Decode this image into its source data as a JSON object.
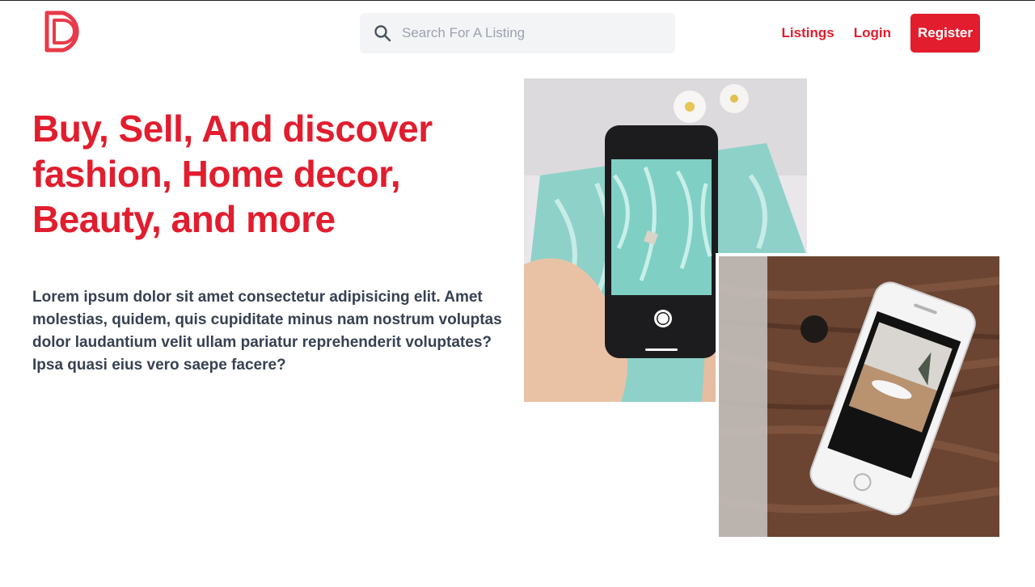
{
  "header": {
    "logo_label": "D logo",
    "search_placeholder": "Search For A Listing",
    "nav": {
      "listings_label": "Listings",
      "login_label": "Login",
      "register_label": "Register"
    }
  },
  "hero": {
    "headline": "Buy, Sell, And discover fashion, Home decor, Beauty, and more",
    "lead": "Lorem ipsum dolor sit amet consectetur adipisicing elit. Amet molestias, quidem, quis cupiditate minus nam nostrum voluptas dolor laudantium velit ullam pariatur reprehenderit voluptates? Ipsa quasi eius vero saepe facere?"
  },
  "colors": {
    "brand": "#e11d2e",
    "text_dark": "#374151",
    "search_bg": "#f3f4f6"
  },
  "icons": {
    "search": "search-icon",
    "logo": "logo-icon"
  }
}
